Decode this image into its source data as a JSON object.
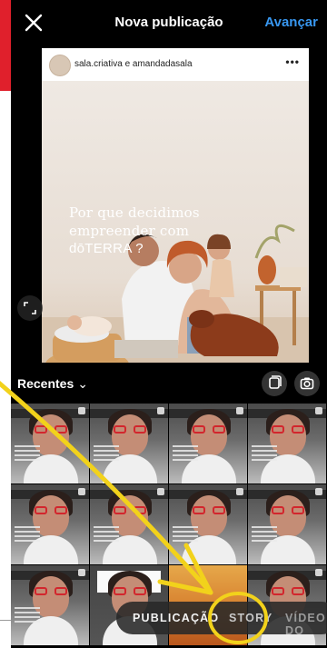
{
  "header": {
    "title": "Nova publicação",
    "next_label": "Avançar"
  },
  "post": {
    "username": "sala.criativa e amandadasala",
    "more_label": "•••",
    "headline_lines": [
      "Por que decidimos",
      "empreender com"
    ],
    "brand": "dōTERRA ?"
  },
  "toolbar": {
    "recents_label": "Recentes",
    "recents_chevron": "⌄"
  },
  "modes": {
    "publication": "PUBLICAÇÃO",
    "story": "STORY",
    "video": "VÍDEO DO"
  },
  "colors": {
    "accent_blue": "#3897f0",
    "annotation_yellow": "#f2d21b",
    "left_red": "#e0202c"
  },
  "icons": [
    "close-icon",
    "expand-icon",
    "multi-select-icon",
    "camera-icon",
    "chevron-down-icon"
  ]
}
